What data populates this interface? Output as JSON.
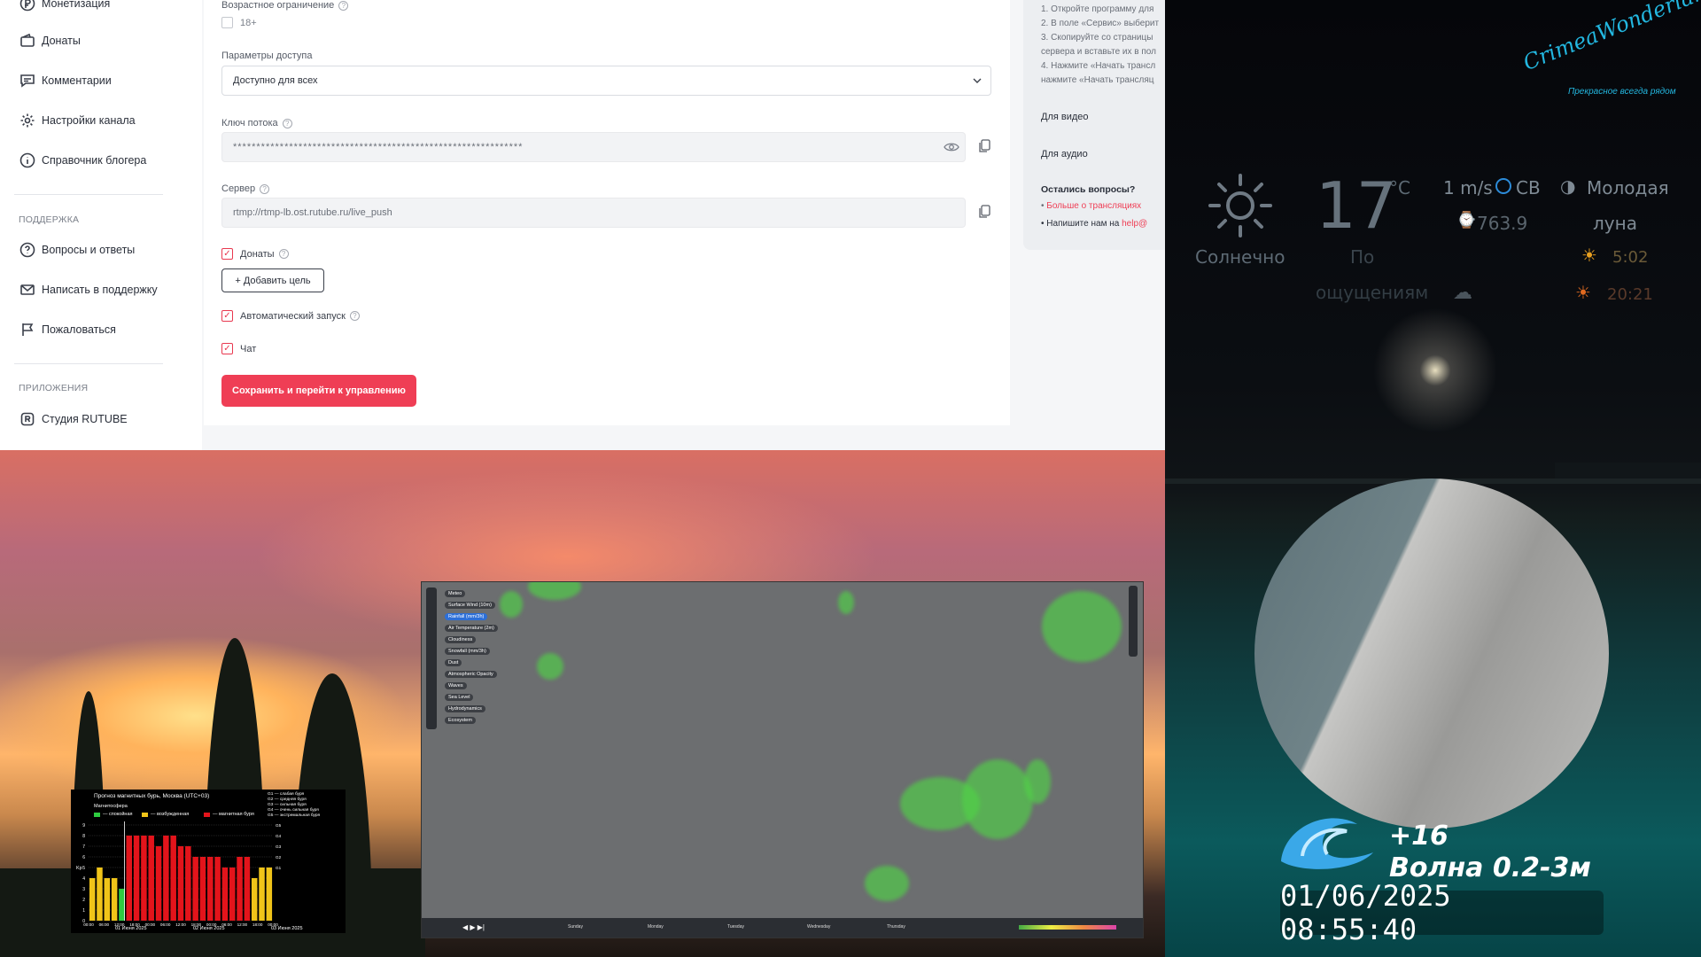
{
  "sidebar": {
    "items_top": [
      {
        "label": "Монетизация",
        "icon": "ruble-icon"
      },
      {
        "label": "Донаты",
        "icon": "wallet-icon"
      },
      {
        "label": "Комментарии",
        "icon": "comment-icon"
      },
      {
        "label": "Настройки канала",
        "icon": "gear-icon"
      },
      {
        "label": "Справочник блогера",
        "icon": "info-icon"
      }
    ],
    "support_title": "ПОДДЕРЖКА",
    "support_items": [
      {
        "label": "Вопросы и ответы",
        "icon": "question-icon"
      },
      {
        "label": "Написать в поддержку",
        "icon": "mail-icon"
      },
      {
        "label": "Пожаловаться",
        "icon": "flag-icon"
      }
    ],
    "apps_title": "ПРИЛОЖЕНИЯ",
    "apps_items": [
      {
        "label": "Студия RUTUBE",
        "icon": "studio-icon"
      }
    ]
  },
  "form": {
    "age_label": "Возрастное ограничение",
    "age_checkbox": "18+",
    "access_label": "Параметры доступа",
    "access_value": "Доступно для всех",
    "key_label": "Ключ потока",
    "key_value": "**************************************************************",
    "server_label": "Сервер",
    "server_value": "rtmp://rtmp-lb.ost.rutube.ru/live_push",
    "donats_label": "Донаты",
    "add_goal": "+ Добавить цель",
    "autostart_label": "Автоматический запуск",
    "chat_label": "Чат",
    "save_button": "Сохранить и перейти к управлению"
  },
  "instructions": {
    "steps": [
      "1. Откройте программу для",
      "2. В поле «Сервис» выберит",
      "3. Скопируйте со страницы",
      "сервера и вставьте их в пол",
      "4. Нажмите «Начать трансл",
      "нажмите «Начать трансляц"
    ],
    "for_video": "Для видео",
    "for_audio": "Для аудио",
    "questions": "Остались вопросы?",
    "link1": "Больше о трансляциях",
    "link2_prefix": "Напишите нам на",
    "link2_link": "help@"
  },
  "storm_chart": {
    "title": "Прогноз магнитных бурь, Москва (UTC+03)",
    "legend_group": "Магнитосфера",
    "legend": [
      "— спокойная",
      "— возбужденная",
      "— магнитная буря"
    ],
    "scale_labels": [
      "G1 — слабая буря",
      "G2 — средняя буря",
      "G3 — сильная буря",
      "G4 — очень сильная буря",
      "G5 — экстремальная буря"
    ],
    "y_axis_label": "Kp",
    "date_labels": [
      "01 Июня 2025",
      "02 Июня 2025",
      "03 Июня 2025"
    ],
    "time_labels": [
      "00:00",
      "06:00",
      "12:00",
      "18:00",
      "00:00",
      "06:00",
      "12:00",
      "18:00",
      "00:00",
      "06:00",
      "12:00",
      "18:00",
      "00:00"
    ],
    "colors": {
      "quiet": "#2ecc40",
      "active": "#f0c419",
      "storm": "#e3141b"
    }
  },
  "chart_data": {
    "type": "bar",
    "title": "Прогноз магнитных бурь, Москва (UTC+03)",
    "ylabel": "Kp",
    "ylim": [
      0,
      9
    ],
    "values": [
      4,
      5,
      4,
      4,
      3,
      8,
      8,
      8,
      8,
      7,
      8,
      8,
      7,
      7,
      6,
      6,
      6,
      6,
      5,
      5,
      6,
      6,
      4,
      5,
      5
    ],
    "classes": [
      "active",
      "active",
      "active",
      "active",
      "quiet",
      "storm",
      "storm",
      "storm",
      "storm",
      "storm",
      "storm",
      "storm",
      "storm",
      "storm",
      "storm",
      "storm",
      "storm",
      "storm",
      "storm",
      "storm",
      "storm",
      "storm",
      "active",
      "active",
      "active"
    ]
  },
  "weather_map": {
    "menu": [
      "Meteo",
      "Surface Wind (10m)",
      "Rainfall (mm/3h)",
      "Air Temperature (2m)",
      "Cloudiness",
      "Snowfall (mm/3h)",
      "Dust",
      "Atmospheric Opacity",
      "Waves",
      "Sea Level",
      "Hydrodynamics",
      "Ecosystem"
    ],
    "active_menu": "Rainfall (mm/3h)",
    "timeline": [
      "Sunday",
      "Monday",
      "Tuesday",
      "Wednesday",
      "Thursday"
    ]
  },
  "weather": {
    "temperature": "17",
    "temp_unit": "°C",
    "condition": "Солнечно",
    "feels": "По",
    "feels2": "ощущениям",
    "wind": "1 m/s",
    "wind_dir": "СВ",
    "pressure": "763.9",
    "moon": "Молодая",
    "moon2": "луна",
    "sunrise": "5:02",
    "sunset": "20:21",
    "wave_temp": "+16",
    "wave_label": "Волна 0.2-3м",
    "clock": "01/06/2025 08:55:40",
    "logo": "CrimeaWonderland",
    "logo_sub": "Прекрасное всегда рядом"
  }
}
